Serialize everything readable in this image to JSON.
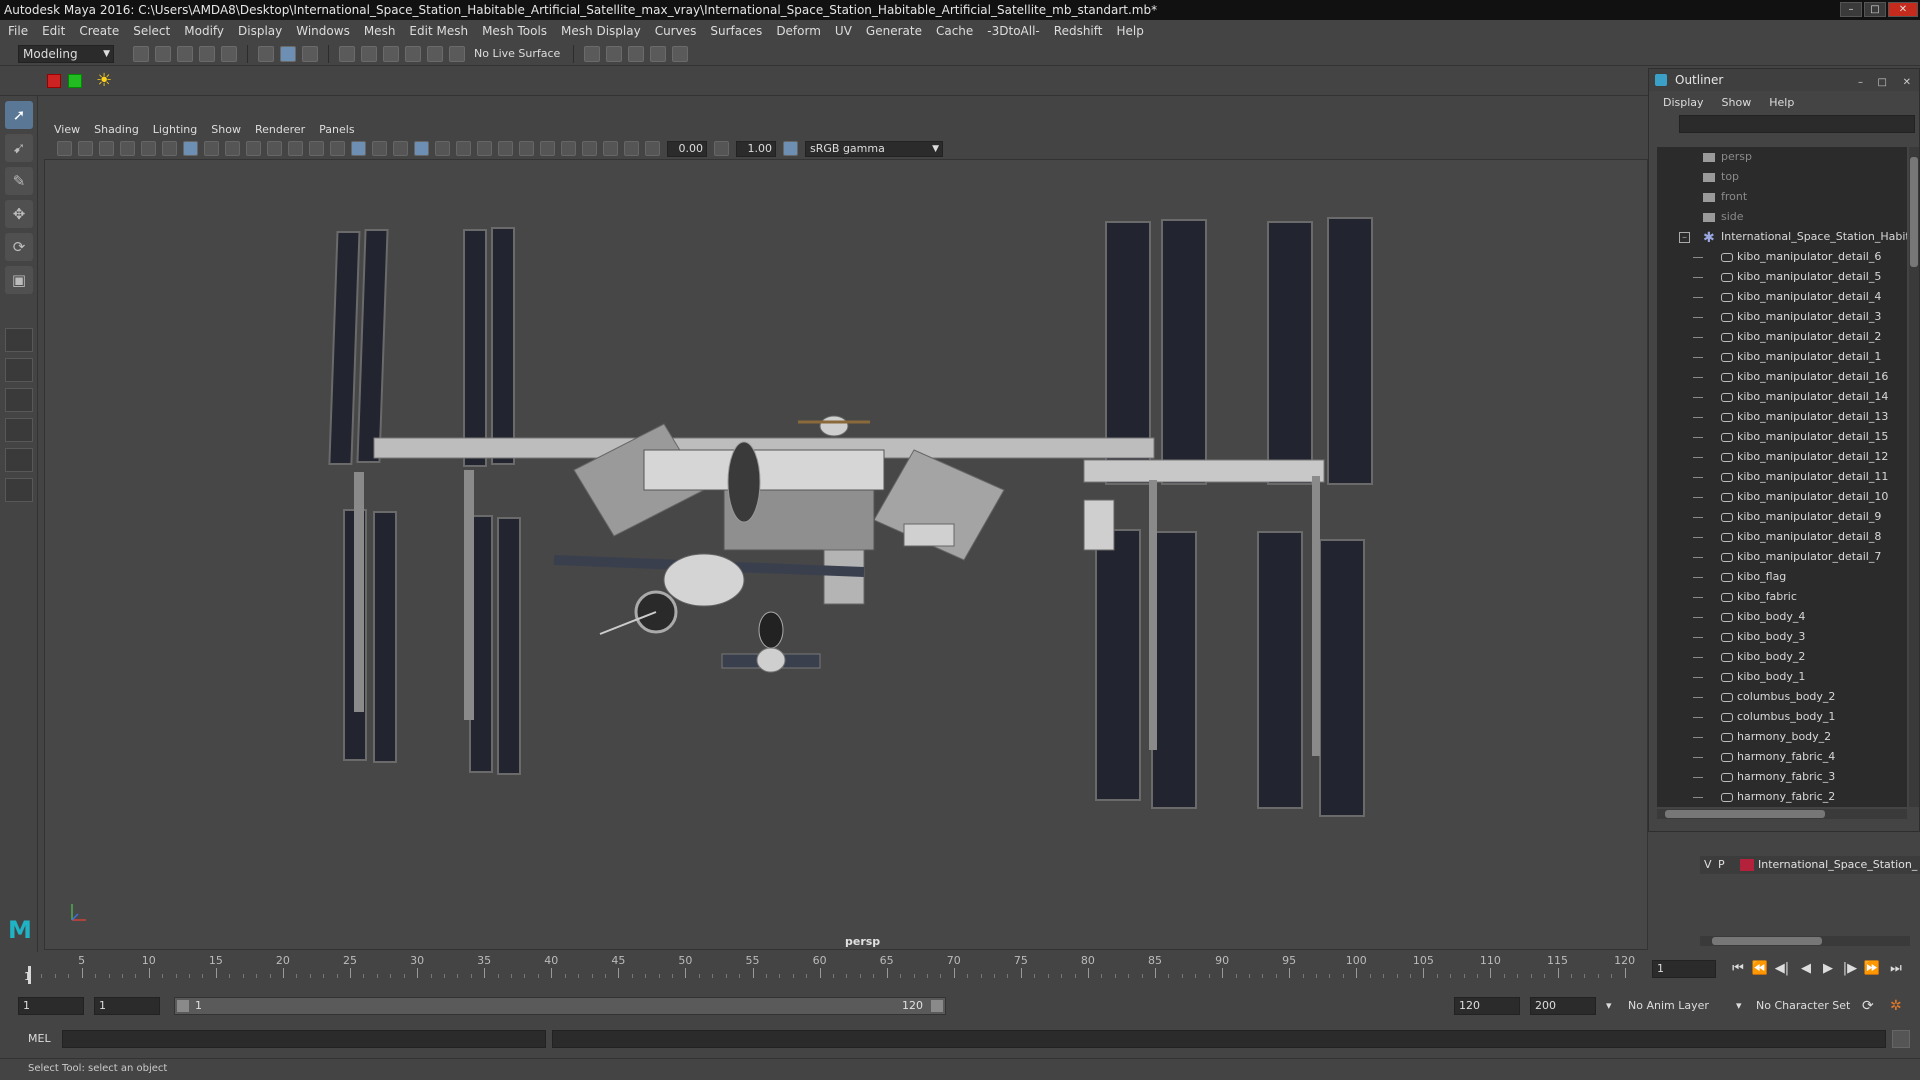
{
  "window": {
    "title": "Autodesk Maya 2016: C:\\Users\\AMDA8\\Desktop\\International_Space_Station_Habitable_Artificial_Satellite_max_vray\\International_Space_Station_Habitable_Artificial_Satellite_mb_standart.mb*",
    "minimize": "–",
    "maximize": "□",
    "close": "✕"
  },
  "menubar": [
    "File",
    "Edit",
    "Create",
    "Select",
    "Modify",
    "Display",
    "Windows",
    "Mesh",
    "Edit Mesh",
    "Mesh Tools",
    "Mesh Display",
    "Curves",
    "Surfaces",
    "Deform",
    "UV",
    "Generate",
    "Cache",
    "-3DtoAll-",
    "Redshift",
    "Help"
  ],
  "statusline": {
    "menu_set": "Modeling",
    "live_surface": "No Live Surface"
  },
  "panel": {
    "menus": [
      "View",
      "Shading",
      "Lighting",
      "Show",
      "Renderer",
      "Panels"
    ],
    "near_value": "0.00",
    "far_value": "1.00",
    "color_space": "sRGB gamma",
    "camera_label": "persp"
  },
  "outliner": {
    "title": "Outliner",
    "menus": [
      "Display",
      "Show",
      "Help"
    ],
    "cameras": [
      "persp",
      "top",
      "front",
      "side"
    ],
    "root": "International_Space_Station_Habita",
    "children": [
      "kibo_manipulator_detail_6",
      "kibo_manipulator_detail_5",
      "kibo_manipulator_detail_4",
      "kibo_manipulator_detail_3",
      "kibo_manipulator_detail_2",
      "kibo_manipulator_detail_1",
      "kibo_manipulator_detail_16",
      "kibo_manipulator_detail_14",
      "kibo_manipulator_detail_13",
      "kibo_manipulator_detail_15",
      "kibo_manipulator_detail_12",
      "kibo_manipulator_detail_11",
      "kibo_manipulator_detail_10",
      "kibo_manipulator_detail_9",
      "kibo_manipulator_detail_8",
      "kibo_manipulator_detail_7",
      "kibo_flag",
      "kibo_fabric",
      "kibo_body_4",
      "kibo_body_3",
      "kibo_body_2",
      "kibo_body_1",
      "columbus_body_2",
      "columbus_body_1",
      "harmony_body_2",
      "harmony_fabric_4",
      "harmony_fabric_3",
      "harmony_fabric_2"
    ]
  },
  "layer_editor": {
    "visible_flag": "V",
    "playback_flag": "P",
    "layer_name": "International_Space_Station_H",
    "layer_color": "#b3213a"
  },
  "timeslider": {
    "tick_labels": [
      "5",
      "10",
      "15",
      "20",
      "25",
      "30",
      "35",
      "40",
      "45",
      "50",
      "55",
      "60",
      "65",
      "70",
      "75",
      "80",
      "85",
      "90",
      "95",
      "100",
      "105",
      "110",
      "115",
      "120"
    ],
    "current_frame_marker": "1",
    "current_frame_field": "1"
  },
  "rangeslider": {
    "start_frame": "1",
    "playback_start": "1",
    "range_start_label": "1",
    "range_end_label": "120",
    "playback_end": "120",
    "end_frame": "200",
    "anim_layer": "No Anim Layer",
    "character_set": "No Character Set"
  },
  "cmdline": {
    "label": "MEL"
  },
  "helpline": {
    "text": "Select Tool: select an object"
  },
  "colors": {
    "accent": "#5a7896",
    "maya_logo": "#1fb3c6",
    "layer": "#b3213a"
  }
}
